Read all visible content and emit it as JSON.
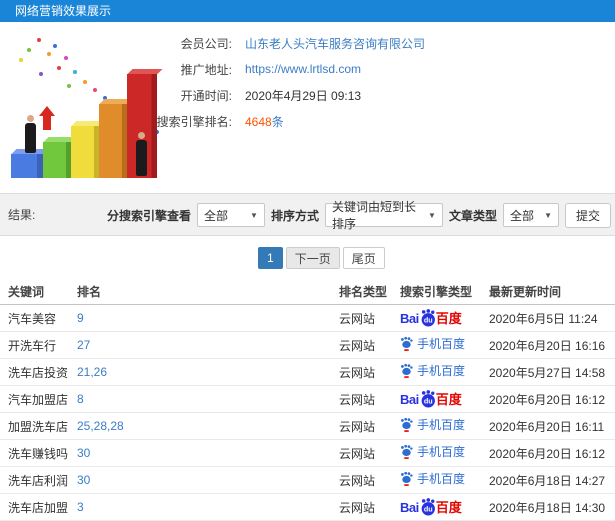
{
  "header": {
    "title": "网络营销效果展示"
  },
  "info": {
    "company_label": "会员公司:",
    "company_value": "山东老人头汽车服务咨询有限公司",
    "url_label": "推广地址:",
    "url_value": "https://www.lrtlsd.com",
    "open_time_label": "开通时间:",
    "open_time_value": "2020年4月29日 09:13",
    "rank_label": "搜索引擎排名:",
    "rank_count": "4648",
    "rank_unit": "条"
  },
  "filters": {
    "result_label": "结果:",
    "engine_label": "分搜索引擎查看",
    "engine_value": "全部",
    "sort_label": "排序方式",
    "sort_value": "关键词由短到长排序",
    "article_label": "文章类型",
    "article_value": "全部",
    "submit_label": "提交"
  },
  "pagination": {
    "current": "1",
    "next": "下一页",
    "last": "尾页"
  },
  "table": {
    "headers": [
      "关键词",
      "排名",
      "排名类型",
      "搜索引擎类型",
      "最新更新时间"
    ],
    "engine_labels": {
      "baidu_pc_bai": "Bai",
      "baidu_pc_du": "du",
      "baidu_pc_cn": "百度",
      "baidu_mobile": "手机百度"
    },
    "rows": [
      {
        "keyword": "汽车美容",
        "rank": "9",
        "rank_type": "云网站",
        "engine": "baidu-pc",
        "updated": "2020年6月5日 11:24"
      },
      {
        "keyword": "开洗车行",
        "rank": "27",
        "rank_type": "云网站",
        "engine": "baidu-mobile",
        "updated": "2020年6月20日 16:16"
      },
      {
        "keyword": "洗车店投资",
        "rank": "21,26",
        "rank_type": "云网站",
        "engine": "baidu-mobile",
        "updated": "2020年5月27日 14:58"
      },
      {
        "keyword": "汽车加盟店",
        "rank": "8",
        "rank_type": "云网站",
        "engine": "baidu-pc",
        "updated": "2020年6月20日 16:12"
      },
      {
        "keyword": "加盟洗车店",
        "rank": "25,28,28",
        "rank_type": "云网站",
        "engine": "baidu-mobile",
        "updated": "2020年6月20日 16:11"
      },
      {
        "keyword": "洗车赚钱吗",
        "rank": "30",
        "rank_type": "云网站",
        "engine": "baidu-mobile",
        "updated": "2020年6月20日 16:12"
      },
      {
        "keyword": "洗车店利润",
        "rank": "30",
        "rank_type": "云网站",
        "engine": "baidu-mobile",
        "updated": "2020年6月18日 14:27"
      },
      {
        "keyword": "洗车店加盟",
        "rank": "3",
        "rank_type": "云网站",
        "engine": "baidu-pc",
        "updated": "2020年6月18日 14:30"
      }
    ]
  },
  "icons": {
    "dropdown_arrow": "▼"
  },
  "colors": {
    "header_bg": "#1a85d6",
    "link_blue": "#3b7dc4",
    "rank_orange": "#ff5100",
    "baidu_blue": "#2932e1",
    "baidu_red": "#e10601",
    "mobile_blue": "#2c6dd2",
    "pagination_active": "#337ab7",
    "filter_bg": "#f1f1f1",
    "border_gray": "#dddddd"
  }
}
